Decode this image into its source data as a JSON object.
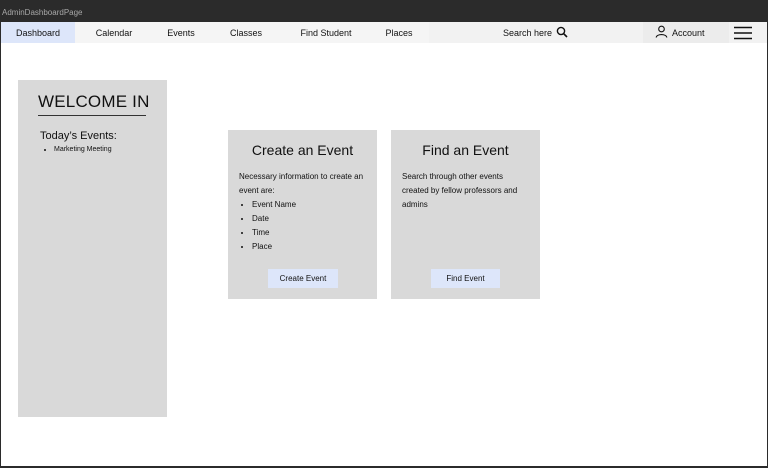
{
  "window": {
    "title": "AdminDashboardPage"
  },
  "nav": {
    "items": [
      {
        "label": "Dashboard",
        "active": true
      },
      {
        "label": "Calendar",
        "active": false
      },
      {
        "label": "Events",
        "active": false
      },
      {
        "label": "Classes",
        "active": false
      },
      {
        "label": "Find Student",
        "active": false
      },
      {
        "label": "Places",
        "active": false
      }
    ],
    "search_label": "Search here",
    "account_label": "Account"
  },
  "welcome": {
    "title": "WELCOME IN",
    "todays_heading": "Today’s Events:",
    "events": [
      "Marketing Meeting"
    ]
  },
  "create_card": {
    "title": "Create an Event",
    "intro": "Necessary information to create an event are:",
    "fields": [
      "Event Name",
      "Date",
      "Time",
      "Place"
    ],
    "button_label": "Create Event"
  },
  "find_card": {
    "title": "Find an Event",
    "description": "Search through other events created by fellow professors and admins",
    "button_label": "Find Event"
  },
  "colors": {
    "title_bar": "#2b2b2b",
    "active_tab": "#dde6fa",
    "panel": "#d9d9d9",
    "button": "#dde6fa"
  }
}
